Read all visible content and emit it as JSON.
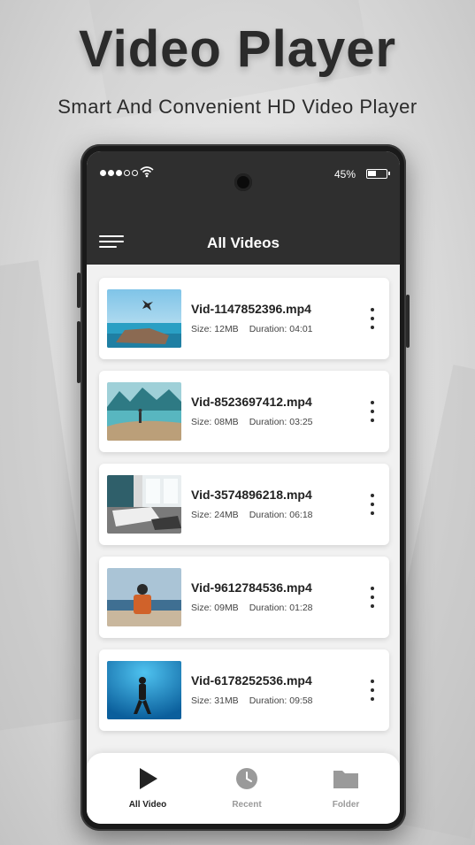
{
  "promo": {
    "title": "Video Player",
    "subtitle": "Smart And Convenient HD Video Player"
  },
  "status": {
    "battery_text": "45%",
    "battery_level": 0.45
  },
  "appbar": {
    "title": "All Videos"
  },
  "videos": [
    {
      "name": "Vid-1147852396.mp4",
      "size": "Size: 12MB",
      "duration": "Duration: 04:01"
    },
    {
      "name": "Vid-8523697412.mp4",
      "size": "Size: 08MB",
      "duration": "Duration: 03:25"
    },
    {
      "name": "Vid-3574896218.mp4",
      "size": "Size: 24MB",
      "duration": "Duration: 06:18"
    },
    {
      "name": "Vid-9612784536.mp4",
      "size": "Size: 09MB",
      "duration": "Duration: 01:28"
    },
    {
      "name": "Vid-6178252536.mp4",
      "size": "Size: 31MB",
      "duration": "Duration: 09:58"
    }
  ],
  "bottom_nav": [
    {
      "label": "All Video",
      "icon": "play-icon",
      "active": true
    },
    {
      "label": "Recent",
      "icon": "clock-icon",
      "active": false
    },
    {
      "label": "Folder",
      "icon": "folder-icon",
      "active": false
    }
  ],
  "colors": {
    "appbar_bg": "#2f2f2f",
    "active_nav": "#222222",
    "inactive_nav": "#9a9a9a"
  }
}
